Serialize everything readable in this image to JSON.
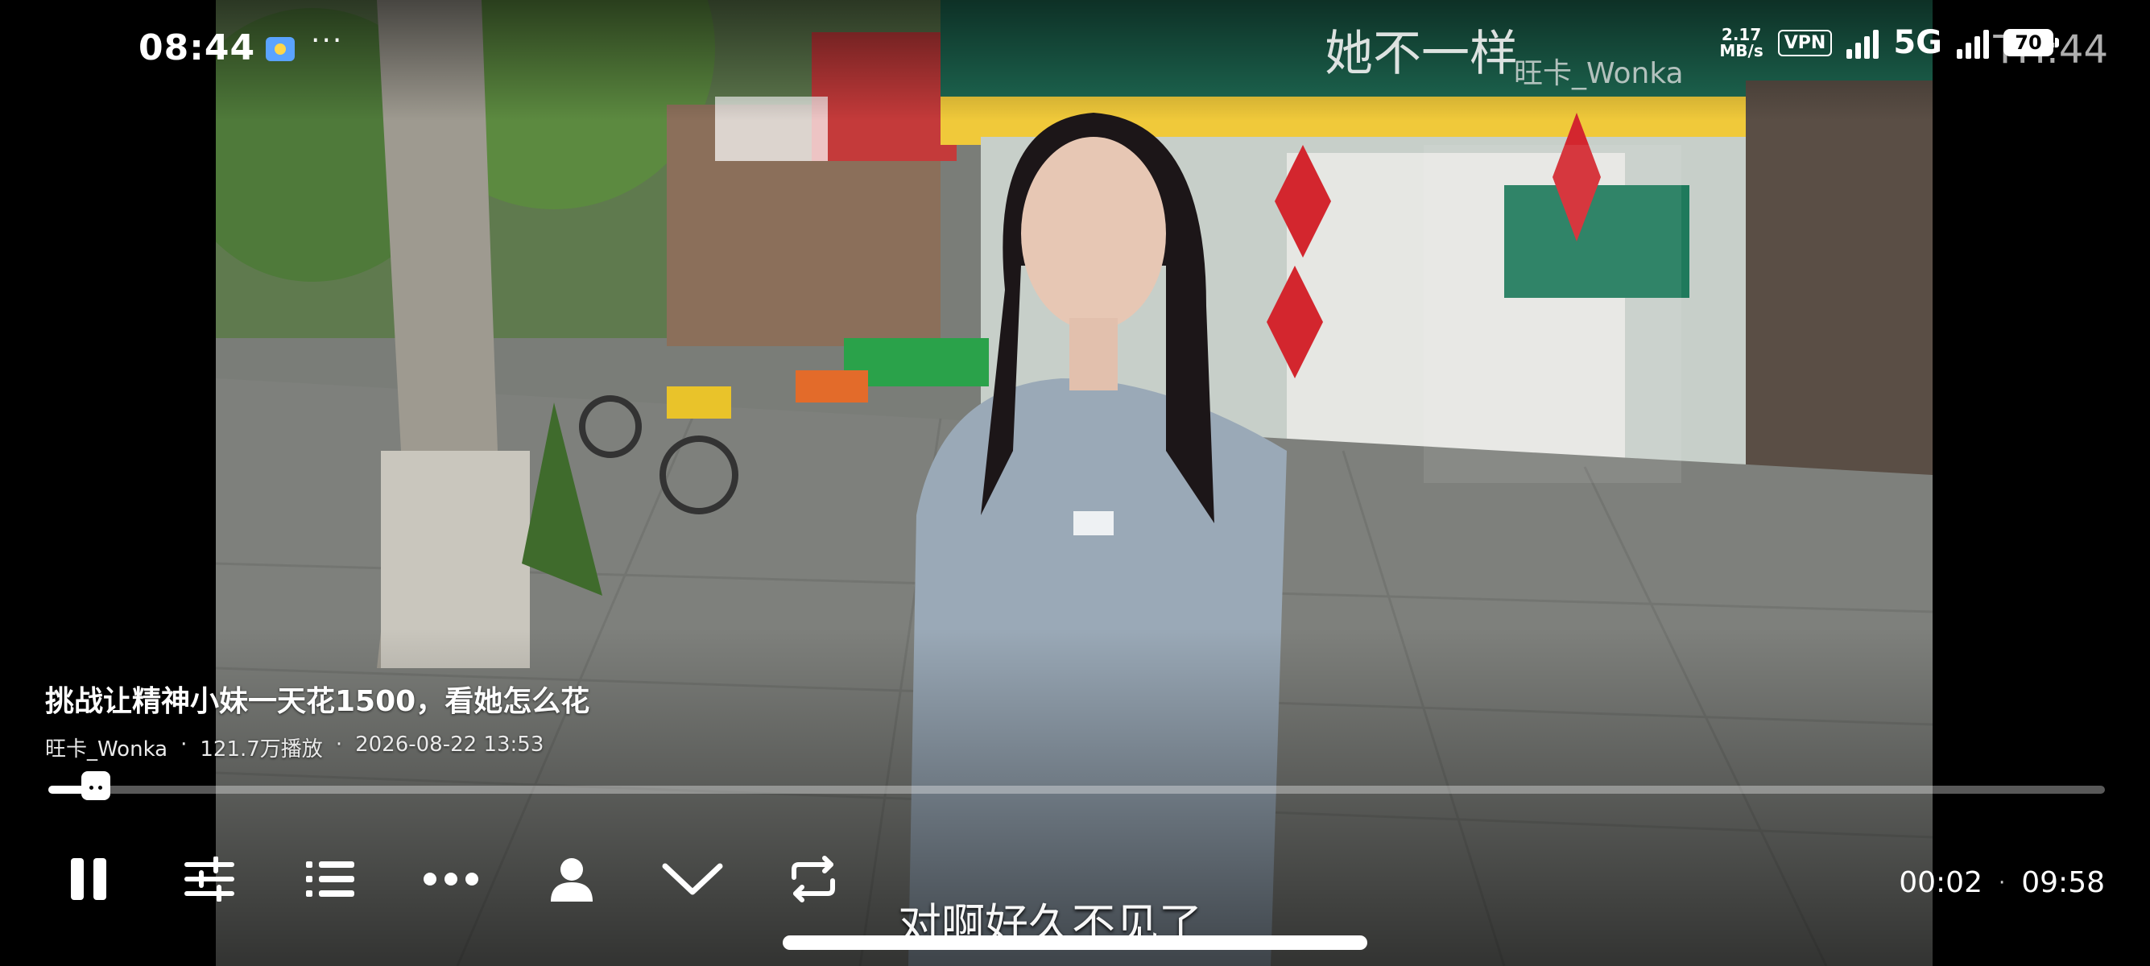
{
  "status_bar": {
    "time": "08:44",
    "overflow_dots": "···",
    "net_speed_value": "2.17",
    "net_speed_unit": "MB/s",
    "vpn_label": "VPN",
    "network_type": "5G",
    "battery_level": "70"
  },
  "video_overlay": {
    "watermark_title": "她不一样",
    "watermark_channel": "旺卡_Wonka",
    "watermark_clock": "TH:44"
  },
  "video_info": {
    "title": "挑战让精神小妹一天花1500，看她怎么花",
    "uploader": "旺卡_Wonka",
    "separator": "·",
    "views": "121.7万播放",
    "upload_time": "2026-08-22 13:53"
  },
  "playback": {
    "current_time": "00:02",
    "separator": "·",
    "duration": "09:58",
    "progress_fraction": 0.03
  },
  "subtitle": {
    "text": "对啊好久不见了"
  },
  "controls": {
    "icons": [
      "pause-icon",
      "settings-sliders-icon",
      "playlist-icon",
      "more-icon",
      "profile-icon",
      "collapse-icon",
      "loop-icon"
    ]
  },
  "colors": {
    "accent": "#ffffff",
    "track": "#8c8c8c",
    "shop_green": "#1e6b54",
    "sign_red": "#d3262e"
  }
}
